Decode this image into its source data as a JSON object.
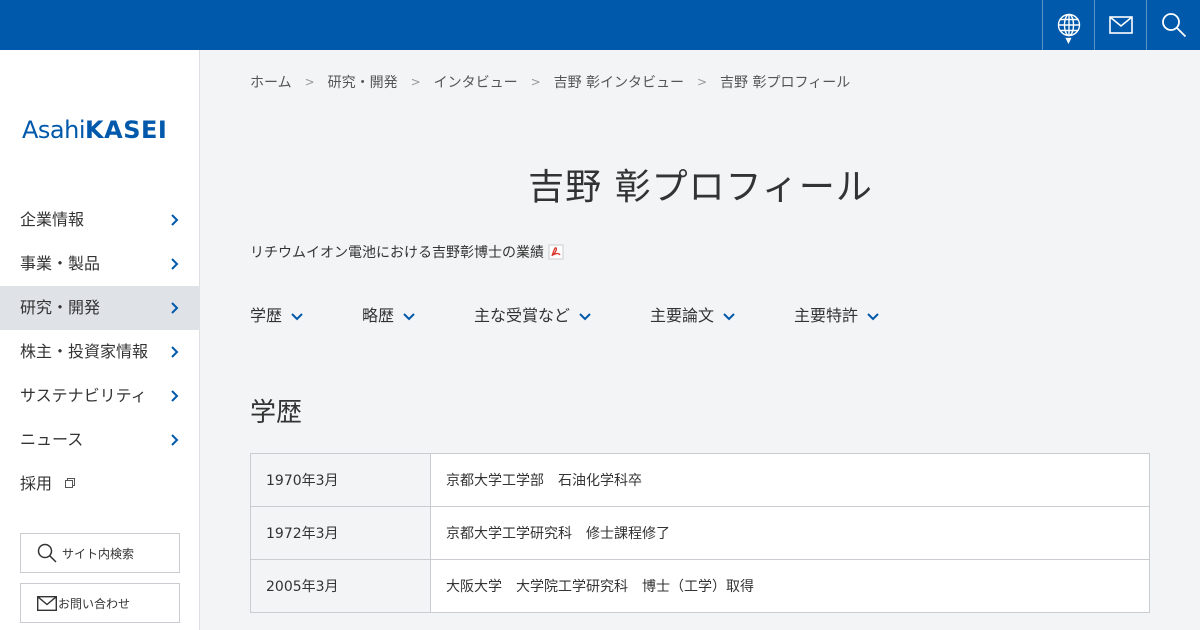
{
  "header": {
    "globe_icon": "globe-icon",
    "mail_icon": "mail-icon",
    "search_icon": "search-icon",
    "bar_color": "#0059ab"
  },
  "logo": {
    "part1": "Asahi",
    "part2": "KASEI"
  },
  "sidebar": {
    "items": [
      {
        "label": "企業情報",
        "active": false
      },
      {
        "label": "事業・製品",
        "active": false
      },
      {
        "label": "研究・開発",
        "active": true
      },
      {
        "label": "株主・投資家情報",
        "active": false
      },
      {
        "label": "サステナビリティ",
        "active": false
      },
      {
        "label": "ニュース",
        "active": false
      },
      {
        "label": "採用",
        "active": false
      }
    ],
    "search_label": "サイト内検索",
    "contact_label": "お問い合わせ"
  },
  "breadcrumb": [
    "ホーム",
    "研究・開発",
    "インタビュー",
    "吉野 彰インタビュー",
    "吉野 彰プロフィール"
  ],
  "page_title": "吉野 彰プロフィール",
  "pdf_link": "リチウムイオン電池における吉野彰博士の業績",
  "anchors": [
    "学歴",
    "略歴",
    "主な受賞など",
    "主要論文",
    "主要特許"
  ],
  "section": {
    "title": "学歴",
    "rows": [
      {
        "year": "1970年3月",
        "desc": "京都大学工学部　石油化学科卒"
      },
      {
        "year": "1972年3月",
        "desc": "京都大学工学研究科　修士課程修了"
      },
      {
        "year": "2005年3月",
        "desc": "大阪大学　大学院工学研究科　博士（工学）取得"
      }
    ]
  }
}
